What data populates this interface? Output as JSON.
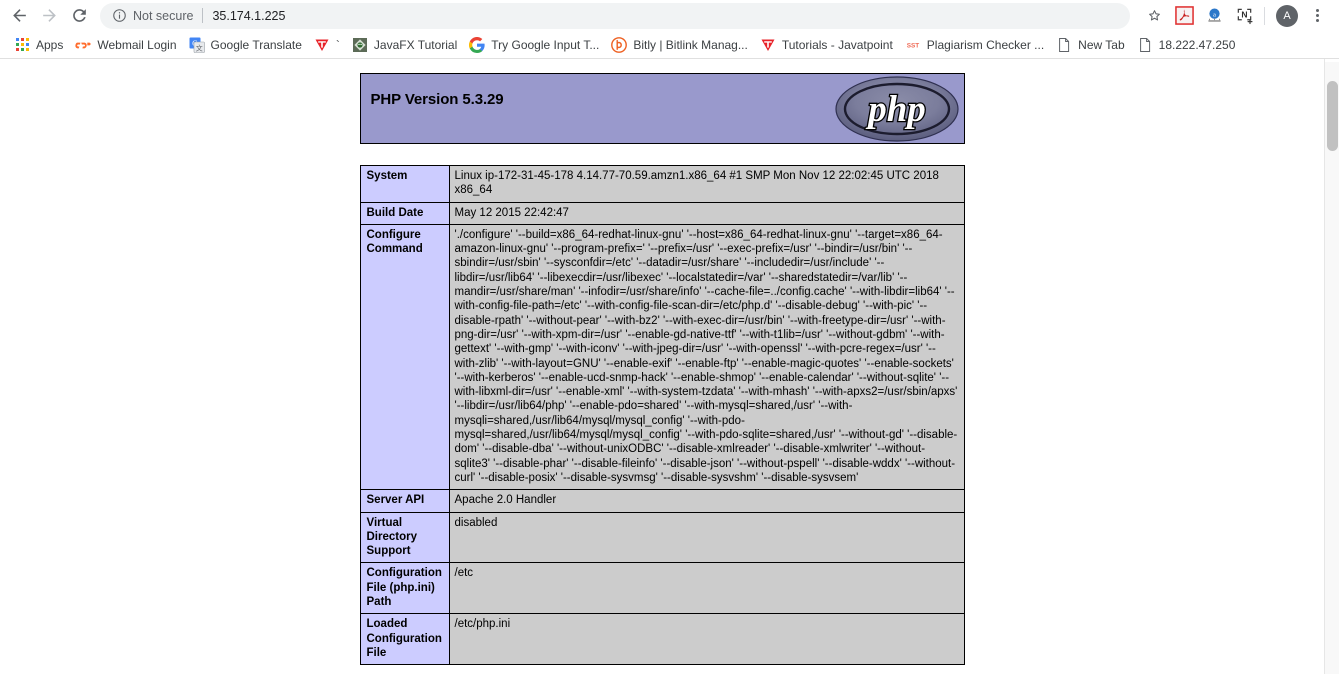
{
  "browser": {
    "nav": {
      "back_label": "Back",
      "forward_label": "Forward",
      "reload_label": "Reload"
    },
    "omnibox": {
      "security_label": "Not secure",
      "security_icon": "info-circle-icon",
      "url": "35.174.1.225"
    },
    "toolbar_icons": [
      {
        "name": "adobe-acrobat-extension-icon",
        "label": "A"
      },
      {
        "name": "grammarly-extension-icon",
        "label": "a"
      },
      {
        "name": "evernote-webclipper-extension-icon",
        "label": "N"
      }
    ],
    "profile": {
      "initial": "A",
      "name": "profile-avatar"
    },
    "star_icon": "bookmark-star-icon",
    "menu_icon": "three-dot-menu-icon"
  },
  "bookmarks": {
    "apps_label": "Apps",
    "items": [
      {
        "label": "Webmail Login",
        "icon": "cpanel-icon"
      },
      {
        "label": "Google Translate",
        "icon": "google-translate-icon"
      },
      {
        "label": "`",
        "icon": "javatpoint-icon"
      },
      {
        "label": "JavaFX Tutorial",
        "icon": "javafx-icon"
      },
      {
        "label": "Try Google Input T...",
        "icon": "google-g-icon"
      },
      {
        "label": "Bitly | Bitlink Manag...",
        "icon": "bitly-icon"
      },
      {
        "label": "Tutorials - Javatpoint",
        "icon": "javatpoint-icon"
      },
      {
        "label": "Plagiarism Checker ...",
        "icon": "smallseotools-icon"
      },
      {
        "label": "New Tab",
        "icon": "page-icon"
      },
      {
        "label": "18.222.47.250",
        "icon": "page-icon"
      }
    ]
  },
  "phpinfo": {
    "version_title": "PHP Version 5.3.29",
    "logo_text": "php",
    "header_bg": "#9999CC",
    "key_bg": "#CCCCFF",
    "value_bg": "#CCCCCC",
    "rows": [
      {
        "key": "System",
        "value": "Linux ip-172-31-45-178 4.14.77-70.59.amzn1.x86_64 #1 SMP Mon Nov 12 22:02:45 UTC 2018 x86_64"
      },
      {
        "key": "Build Date",
        "value": "May 12 2015 22:42:47"
      },
      {
        "key": "Configure Command",
        "value": "'./configure'  '--build=x86_64-redhat-linux-gnu' '--host=x86_64-redhat-linux-gnu' '--target=x86_64-amazon-linux-gnu' '--program-prefix=' '--prefix=/usr' '--exec-prefix=/usr' '--bindir=/usr/bin' '--sbindir=/usr/sbin' '--sysconfdir=/etc' '--datadir=/usr/share' '--includedir=/usr/include' '--libdir=/usr/lib64' '--libexecdir=/usr/libexec' '--localstatedir=/var' '--sharedstatedir=/var/lib' '--mandir=/usr/share/man' '--infodir=/usr/share/info' '--cache-file=../config.cache' '--with-libdir=lib64' '--with-config-file-path=/etc' '--with-config-file-scan-dir=/etc/php.d' '--disable-debug' '--with-pic' '--disable-rpath' '--without-pear' '--with-bz2' '--with-exec-dir=/usr/bin' '--with-freetype-dir=/usr' '--with-png-dir=/usr' '--with-xpm-dir=/usr' '--enable-gd-native-ttf' '--with-t1lib=/usr' '--without-gdbm' '--with-gettext' '--with-gmp' '--with-iconv' '--with-jpeg-dir=/usr' '--with-openssl' '--with-pcre-regex=/usr' '--with-zlib' '--with-layout=GNU' '--enable-exif' '--enable-ftp' '--enable-magic-quotes' '--enable-sockets' '--with-kerberos' '--enable-ucd-snmp-hack' '--enable-shmop' '--enable-calendar' '--without-sqlite' '--with-libxml-dir=/usr' '--enable-xml' '--with-system-tzdata' '--with-mhash' '--with-apxs2=/usr/sbin/apxs' '--libdir=/usr/lib64/php' '--enable-pdo=shared' '--with-mysql=shared,/usr' '--with-mysqli=shared,/usr/lib64/mysql/mysql_config' '--with-pdo-mysql=shared,/usr/lib64/mysql/mysql_config' '--with-pdo-sqlite=shared,/usr' '--without-gd' '--disable-dom' '--disable-dba' '--without-unixODBC' '--disable-xmlreader' '--disable-xmlwriter' '--without-sqlite3' '--disable-phar' '--disable-fileinfo' '--disable-json' '--without-pspell' '--disable-wddx' '--without-curl' '--disable-posix' '--disable-sysvmsg' '--disable-sysvshm' '--disable-sysvsem'"
      },
      {
        "key": "Server API",
        "value": "Apache 2.0 Handler"
      },
      {
        "key": "Virtual Directory Support",
        "value": "disabled"
      },
      {
        "key": "Configuration File (php.ini) Path",
        "value": "/etc"
      },
      {
        "key": "Loaded Configuration File",
        "value": "/etc/php.ini"
      }
    ]
  }
}
